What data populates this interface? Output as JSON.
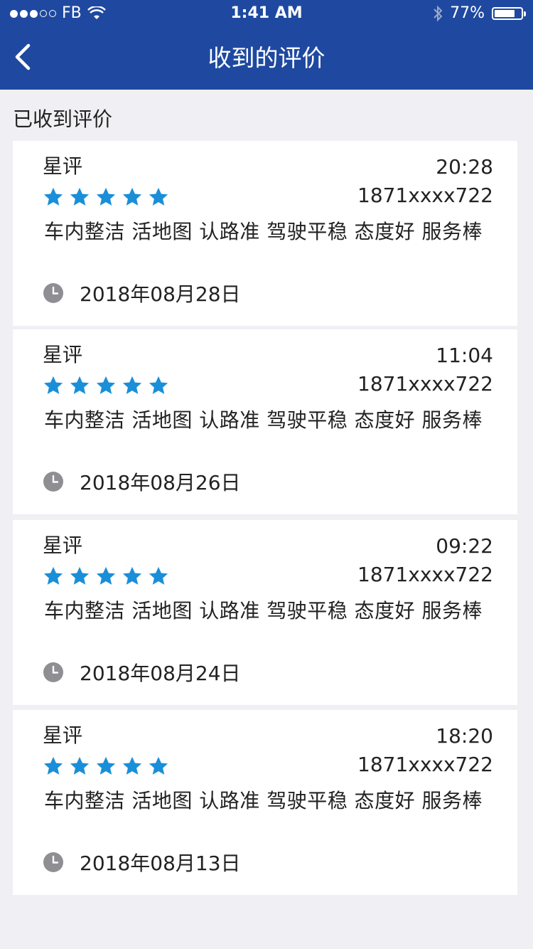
{
  "status_bar": {
    "carrier": "FB",
    "time": "1:41 AM",
    "battery": "77%",
    "battery_level": 0.77
  },
  "nav": {
    "title": "收到的评价",
    "back_icon": "chevron-left-icon"
  },
  "section_title": "已收到评价",
  "reviews": [
    {
      "label": "星评",
      "time": "20:28",
      "phone": "1871xxxx722",
      "rating": 5,
      "tags": "车内整洁 活地图 认路准 驾驶平稳 态度好 服务棒",
      "date": "2018年08月28日"
    },
    {
      "label": "星评",
      "time": "11:04",
      "phone": "1871xxxx722",
      "rating": 5,
      "tags": "车内整洁 活地图 认路准 驾驶平稳 态度好 服务棒",
      "date": "2018年08月26日"
    },
    {
      "label": "星评",
      "time": "09:22",
      "phone": "1871xxxx722",
      "rating": 5,
      "tags": "车内整洁 活地图 认路准 驾驶平稳 态度好 服务棒",
      "date": "2018年08月24日"
    },
    {
      "label": "星评",
      "time": "18:20",
      "phone": "1871xxxx722",
      "rating": 5,
      "tags": "车内整洁 活地图 认路准 驾驶平稳 态度好 服务棒",
      "date": "2018年08月13日"
    }
  ],
  "colors": {
    "header": "#1f49a0",
    "star": "#1a8fd8",
    "clock": "#8e8e93",
    "background": "#efeff4"
  }
}
